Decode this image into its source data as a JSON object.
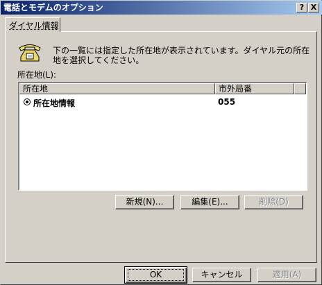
{
  "window": {
    "title": "電話とモデムのオプション",
    "help_button": "?",
    "close_button": "X"
  },
  "tabs": [
    {
      "label": "ダイヤル情報",
      "selected": true
    }
  ],
  "panel": {
    "icon": "telephone-icon",
    "description": "下の一覧には指定した所在地が表示されています。ダイヤル元の所在地を選択してください。",
    "locations_label": "所在地(L):",
    "table": {
      "columns": [
        "所在地",
        "市外局番"
      ],
      "rows": [
        {
          "location": "所在地情報",
          "area_code": "055",
          "selected": true
        }
      ]
    },
    "buttons": {
      "new": "新規(N)...",
      "edit": "編集(E)...",
      "delete": "削除(D)"
    }
  },
  "footer": {
    "ok": "OK",
    "cancel": "キャンセル",
    "apply": "適用(A)"
  },
  "colors": {
    "titlebar_start": "#0a246a",
    "titlebar_end": "#a6caf0",
    "face": "#d4d0c8"
  }
}
